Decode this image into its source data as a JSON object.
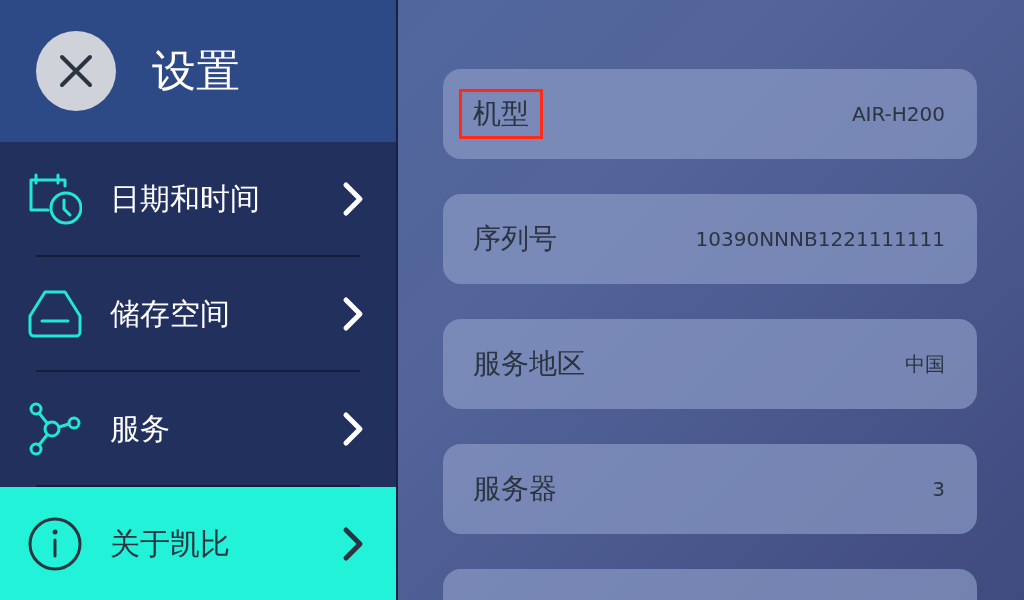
{
  "header": {
    "title": "设置"
  },
  "menu": [
    {
      "kind": "calendar",
      "label": "日期和时间",
      "selected": false
    },
    {
      "kind": "storage",
      "label": "储存空间",
      "selected": false
    },
    {
      "kind": "service",
      "label": "服务",
      "selected": false
    },
    {
      "kind": "info",
      "label": "关于凯比",
      "selected": true
    }
  ],
  "info_rows": [
    {
      "label": "机型",
      "value": "AIR-H200",
      "highlighted": true
    },
    {
      "label": "序列号",
      "value": "10390NNNB1221111111",
      "highlighted": false
    },
    {
      "label": "服务地区",
      "value": "中国",
      "highlighted": false
    },
    {
      "label": "服务器",
      "value": "3",
      "highlighted": false
    }
  ],
  "cut_off_card": true
}
